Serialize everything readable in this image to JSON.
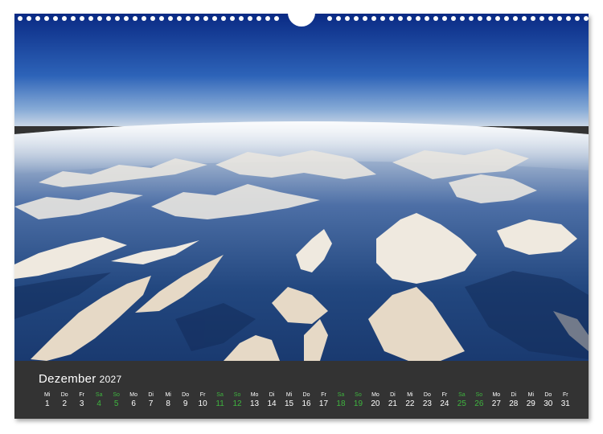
{
  "calendar": {
    "month": "Dezember",
    "year": "2027",
    "weekend_color": "#3fb53f",
    "text_color": "#ffffff",
    "bar_color": "#333333",
    "days": [
      {
        "wd": "Mi",
        "d": "1",
        "we": false
      },
      {
        "wd": "Do",
        "d": "2",
        "we": false
      },
      {
        "wd": "Fr",
        "d": "3",
        "we": false
      },
      {
        "wd": "Sa",
        "d": "4",
        "we": true
      },
      {
        "wd": "So",
        "d": "5",
        "we": true
      },
      {
        "wd": "Mo",
        "d": "6",
        "we": false
      },
      {
        "wd": "Di",
        "d": "7",
        "we": false
      },
      {
        "wd": "Mi",
        "d": "8",
        "we": false
      },
      {
        "wd": "Do",
        "d": "9",
        "we": false
      },
      {
        "wd": "Fr",
        "d": "10",
        "we": false
      },
      {
        "wd": "Sa",
        "d": "11",
        "we": true
      },
      {
        "wd": "So",
        "d": "12",
        "we": true
      },
      {
        "wd": "Mo",
        "d": "13",
        "we": false
      },
      {
        "wd": "Di",
        "d": "14",
        "we": false
      },
      {
        "wd": "Mi",
        "d": "15",
        "we": false
      },
      {
        "wd": "Do",
        "d": "16",
        "we": false
      },
      {
        "wd": "Fr",
        "d": "17",
        "we": false
      },
      {
        "wd": "Sa",
        "d": "18",
        "we": true
      },
      {
        "wd": "So",
        "d": "19",
        "we": true
      },
      {
        "wd": "Mo",
        "d": "20",
        "we": false
      },
      {
        "wd": "Di",
        "d": "21",
        "we": false
      },
      {
        "wd": "Mi",
        "d": "22",
        "we": false
      },
      {
        "wd": "Do",
        "d": "23",
        "we": false
      },
      {
        "wd": "Fr",
        "d": "24",
        "we": false
      },
      {
        "wd": "Sa",
        "d": "25",
        "we": true
      },
      {
        "wd": "So",
        "d": "26",
        "we": true
      },
      {
        "wd": "Mo",
        "d": "27",
        "we": false
      },
      {
        "wd": "Di",
        "d": "28",
        "we": false
      },
      {
        "wd": "Mi",
        "d": "29",
        "we": false
      },
      {
        "wd": "Do",
        "d": "30",
        "we": false
      },
      {
        "wd": "Fr",
        "d": "31",
        "we": false
      }
    ]
  },
  "photo": {
    "sky_top": "#0b2f8a",
    "sky_horizon": "#8fb2d8",
    "terrain_dark": "#1d3f7a",
    "snow": "#e8e4dc"
  }
}
